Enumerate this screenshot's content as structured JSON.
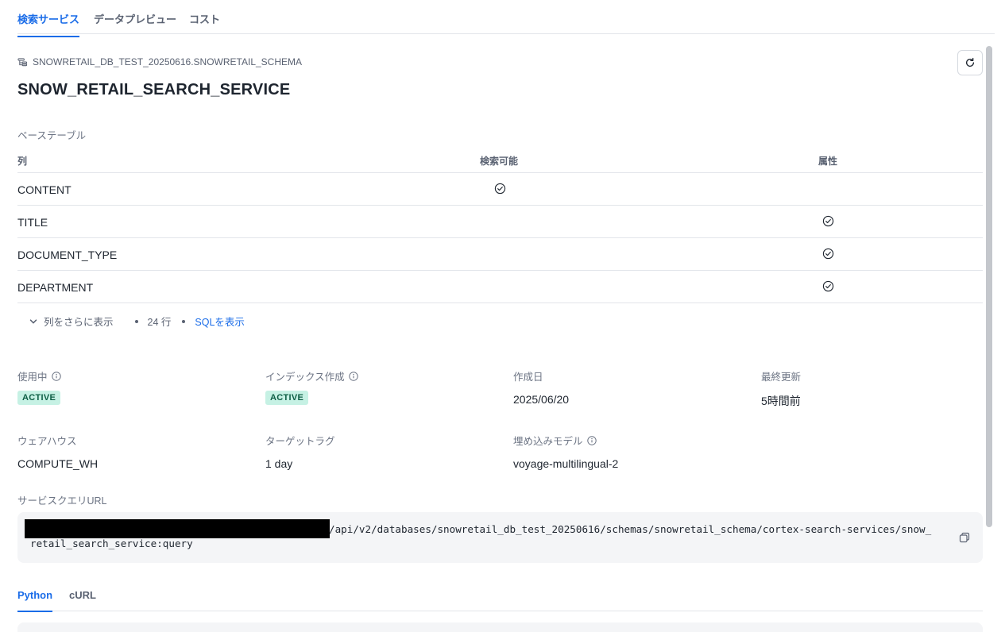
{
  "top_tabs": [
    {
      "label": "検索サービス",
      "active": true
    },
    {
      "label": "データプレビュー",
      "active": false
    },
    {
      "label": "コスト",
      "active": false
    }
  ],
  "breadcrumb": "SNOWRETAIL_DB_TEST_20250616.SNOWRETAIL_SCHEMA",
  "title": "SNOW_RETAIL_SEARCH_SERVICE",
  "base_table_label": "ベーステーブル",
  "table": {
    "headers": {
      "column": "列",
      "searchable": "検索可能",
      "attribute": "属性"
    },
    "rows": [
      {
        "name": "CONTENT",
        "searchable": true,
        "attribute": false
      },
      {
        "name": "TITLE",
        "searchable": false,
        "attribute": true
      },
      {
        "name": "DOCUMENT_TYPE",
        "searchable": false,
        "attribute": true
      },
      {
        "name": "DEPARTMENT",
        "searchable": false,
        "attribute": true
      }
    ]
  },
  "more": {
    "show_more": "列をさらに表示",
    "row_count": "24 行",
    "show_sql": "SQLを表示"
  },
  "props": {
    "serving": {
      "label": "使用中",
      "value": "ACTIVE"
    },
    "indexing": {
      "label": "インデックス作成",
      "value": "ACTIVE"
    },
    "created": {
      "label": "作成日",
      "value": "2025/06/20"
    },
    "last_updated": {
      "label": "最終更新",
      "value": "5時間前"
    },
    "warehouse": {
      "label": "ウェアハウス",
      "value": "COMPUTE_WH"
    },
    "target_lag": {
      "label": "ターゲットラグ",
      "value": "1 day"
    },
    "embedding_model": {
      "label": "埋め込みモデル",
      "value": "voyage-multilingual-2"
    }
  },
  "service_url": {
    "label": "サービスクエリURL",
    "value": "/api/v2/databases/snowretail_db_test_20250616/schemas/snowretail_schema/cortex-search-services/snow_retail_search_service:query"
  },
  "code_tabs": [
    {
      "label": "Python",
      "active": true
    },
    {
      "label": "cURL",
      "active": false
    }
  ],
  "colors": {
    "accent": "#1a6ce8",
    "badge_bg": "#c6f1e4",
    "badge_text": "#0e5e45"
  }
}
